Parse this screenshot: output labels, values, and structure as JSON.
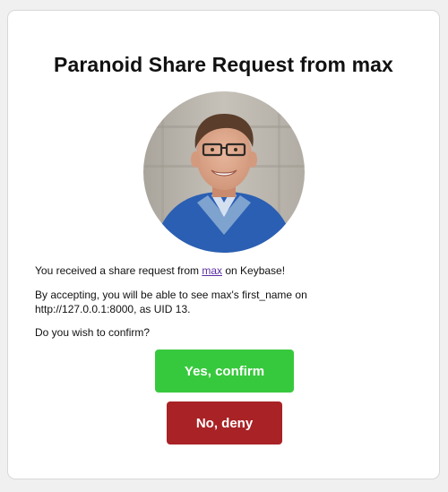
{
  "dialog": {
    "title": "Paranoid Share Request from max",
    "message": {
      "prefix": "You received a share request from ",
      "username_link": "max",
      "suffix": " on Keybase!"
    },
    "details": "By accepting, you will be able to see max's first_name on http://127.0.0.1:8000, as UID 13.",
    "question": "Do you wish to confirm?",
    "confirm_label": "Yes, confirm",
    "deny_label": "No, deny"
  },
  "colors": {
    "confirm": "#37c93d",
    "deny": "#a82226",
    "link": "#5b2fa0"
  }
}
